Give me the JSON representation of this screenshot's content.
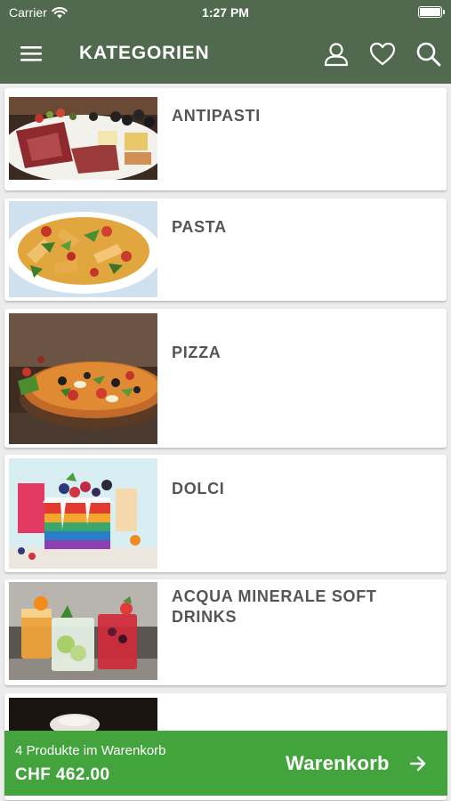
{
  "status_bar": {
    "carrier": "Carrier",
    "time": "1:27 PM"
  },
  "app_bar": {
    "title": "KATEGORIEN",
    "icons": [
      "menu-icon",
      "account-icon",
      "heart-icon",
      "search-icon"
    ]
  },
  "categories": [
    {
      "label": "ANTIPASTI",
      "image": "antipasti-platter"
    },
    {
      "label": "PASTA",
      "image": "pasta-salad"
    },
    {
      "label": "PIZZA",
      "image": "pizza"
    },
    {
      "label": "DOLCI",
      "image": "layered-cake"
    },
    {
      "label": "ACQUA MINERALE SOFT DRINKS",
      "image": "cocktail-glasses"
    },
    {
      "label": "",
      "image": "dark-plate"
    }
  ],
  "cart": {
    "count_text": "4 Produkte im Warenkorb",
    "total": "CHF 462.00",
    "button_label": "Warenkorb"
  },
  "colors": {
    "header": "#51694f",
    "cart_bar": "#43a43d",
    "background": "#ececec",
    "card": "#ffffff",
    "label": "#555555"
  }
}
